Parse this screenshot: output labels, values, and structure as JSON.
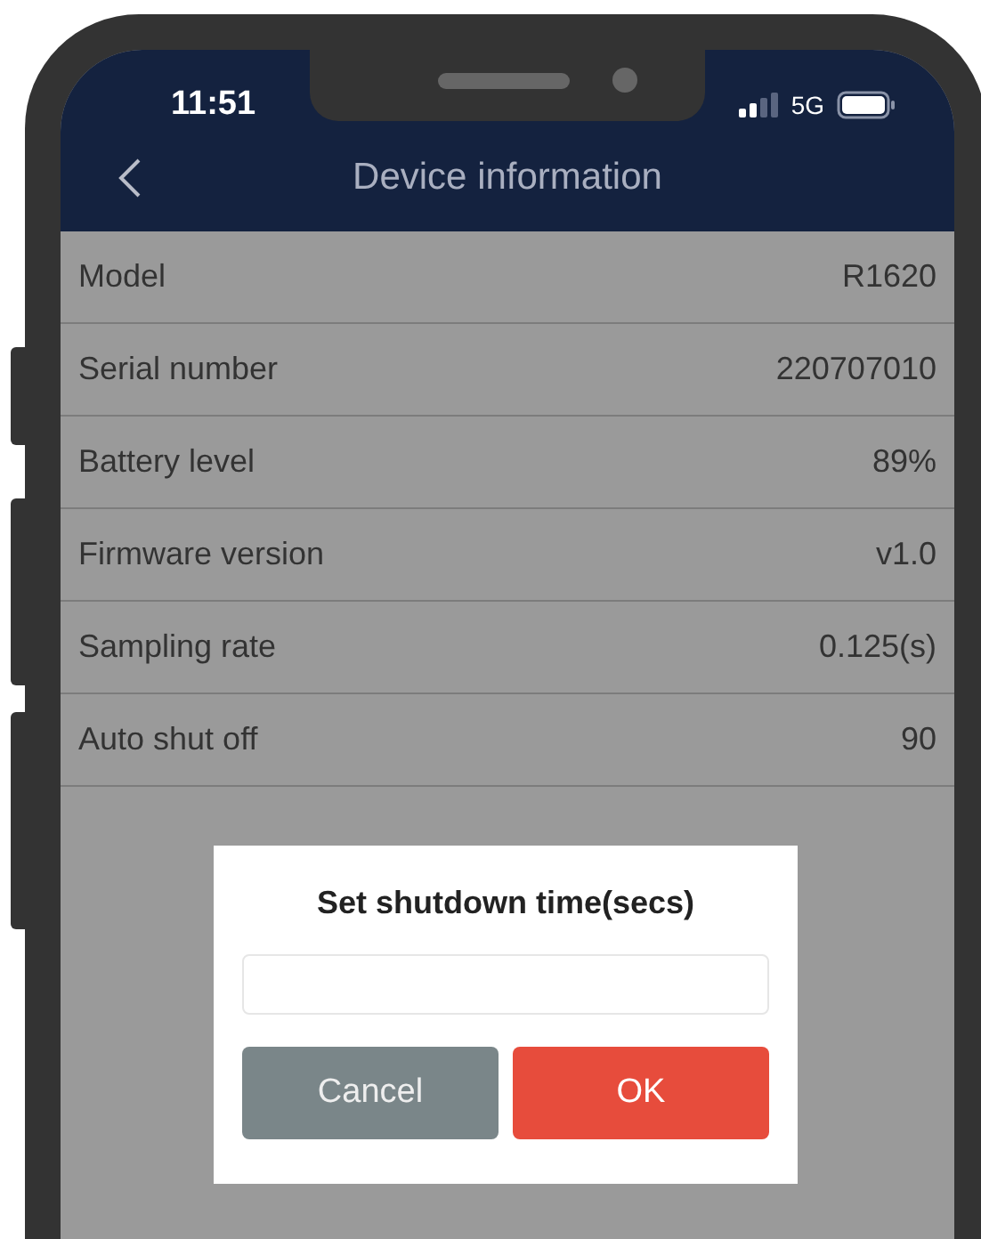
{
  "status_bar": {
    "time": "11:51",
    "network": "5G"
  },
  "header": {
    "title": "Device information"
  },
  "rows": [
    {
      "label": "Model",
      "value": "R1620"
    },
    {
      "label": "Serial number",
      "value": "220707010"
    },
    {
      "label": "Battery level",
      "value": "89%"
    },
    {
      "label": "Firmware version",
      "value": "v1.0"
    },
    {
      "label": "Sampling rate",
      "value": "0.125(s)"
    },
    {
      "label": "Auto shut off",
      "value": "90"
    }
  ],
  "dialog": {
    "title": "Set shutdown time(secs)",
    "buttons": [
      {
        "label": "Cancel",
        "kind": "cancel"
      },
      {
        "label": "OK",
        "kind": "confirm"
      }
    ]
  }
}
